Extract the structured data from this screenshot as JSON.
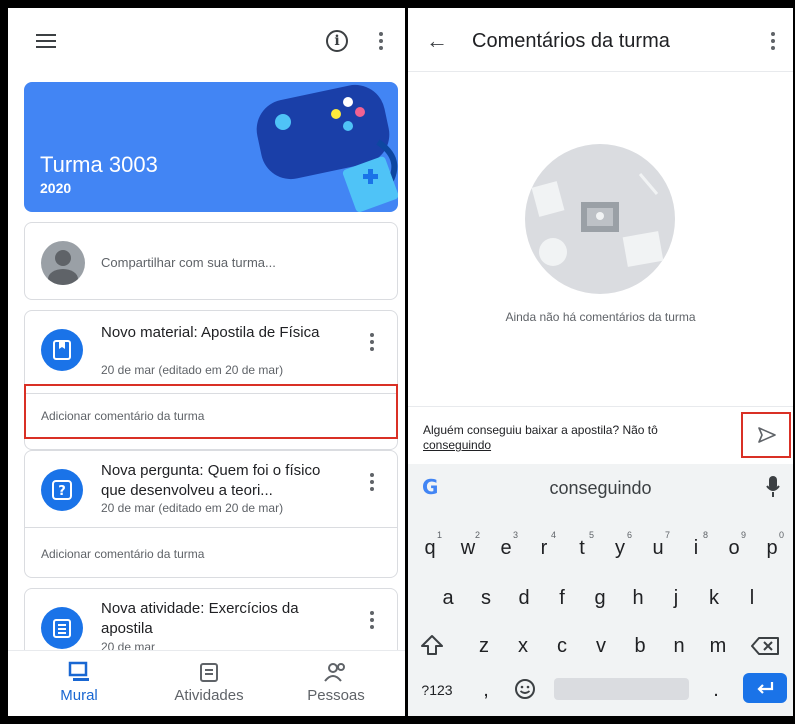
{
  "left": {
    "banner": {
      "title": "Turma 3003",
      "year": "2020",
      "color": "#4285f4"
    },
    "share_placeholder": "Compartilhar com sua turma...",
    "posts": [
      {
        "title": "Novo material: Apostila de Física",
        "date": "20 de mar (editado em 20 de mar)",
        "comment": "Adicionar comentário da turma",
        "icon": "book-icon"
      },
      {
        "title": "Nova pergunta: Quem foi o físico que desenvolveu a teori...",
        "date": "20 de mar (editado em 20 de mar)",
        "comment": "Adicionar comentário da turma",
        "icon": "question-icon"
      },
      {
        "title": "Nova atividade: Exercícios da apostila",
        "date": "20 de mar",
        "icon": "assignment-icon"
      }
    ],
    "nav": [
      {
        "label": "Mural",
        "icon": "stream-icon"
      },
      {
        "label": "Atividades",
        "icon": "classwork-icon"
      },
      {
        "label": "Pessoas",
        "icon": "people-icon"
      }
    ]
  },
  "right": {
    "title": "Comentários da turma",
    "empty_text": "Ainda não há comentários da turma",
    "compose_text": "Alguém conseguiu baixar a apostila? Não tô",
    "compose_underlined": "conseguindo",
    "keyboard": {
      "suggestion": "conseguindo",
      "row1": [
        "q",
        "w",
        "e",
        "r",
        "t",
        "y",
        "u",
        "i",
        "o",
        "p"
      ],
      "row1_nums": [
        "1",
        "2",
        "3",
        "4",
        "5",
        "6",
        "7",
        "8",
        "9",
        "0"
      ],
      "row2": [
        "a",
        "s",
        "d",
        "f",
        "g",
        "h",
        "j",
        "k",
        "l"
      ],
      "row3": [
        "z",
        "x",
        "c",
        "v",
        "b",
        "n",
        "m"
      ],
      "symbols_key": "?123",
      "comma": ",",
      "period": "."
    }
  },
  "colors": {
    "accent": "#1a73e8",
    "highlight": "#d93025"
  }
}
